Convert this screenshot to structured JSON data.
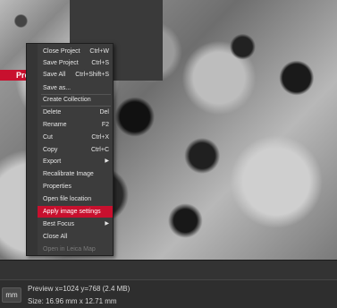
{
  "thumbnail": {
    "label": "Pre"
  },
  "context_menu": {
    "items": [
      {
        "label": "Close Project",
        "shortcut": "Ctrl+W"
      },
      {
        "label": "Save Project",
        "shortcut": "Ctrl+S"
      },
      {
        "label": "Save All",
        "shortcut": "Ctrl+Shift+S"
      },
      {
        "label": "Save as..."
      },
      {
        "label": "Create Collection"
      },
      {
        "label": "Delete",
        "shortcut": "Del"
      },
      {
        "label": "Rename",
        "shortcut": "F2"
      },
      {
        "label": "Cut",
        "shortcut": "Ctrl+X"
      },
      {
        "label": "Copy",
        "shortcut": "Ctrl+C"
      },
      {
        "label": "Export",
        "submenu": "▶"
      },
      {
        "label": "Recalibrate Image"
      },
      {
        "label": "Properties"
      },
      {
        "label": "Open file location"
      },
      {
        "label": "Apply image settings"
      },
      {
        "label": "Best Focus",
        "submenu": "▶"
      },
      {
        "label": "Close All"
      },
      {
        "label": "Open in Leica Map"
      }
    ],
    "highlighted_item": "Apply image settings",
    "disabled_item": "Open in Leica Map",
    "accent_color": "#c8102e"
  },
  "status_bar": {
    "unit_button": "mm",
    "preview_info": "Preview x=1024 y=768  (2.4 MB)",
    "size_info": "Size: 16.96 mm x 12.71 mm"
  }
}
